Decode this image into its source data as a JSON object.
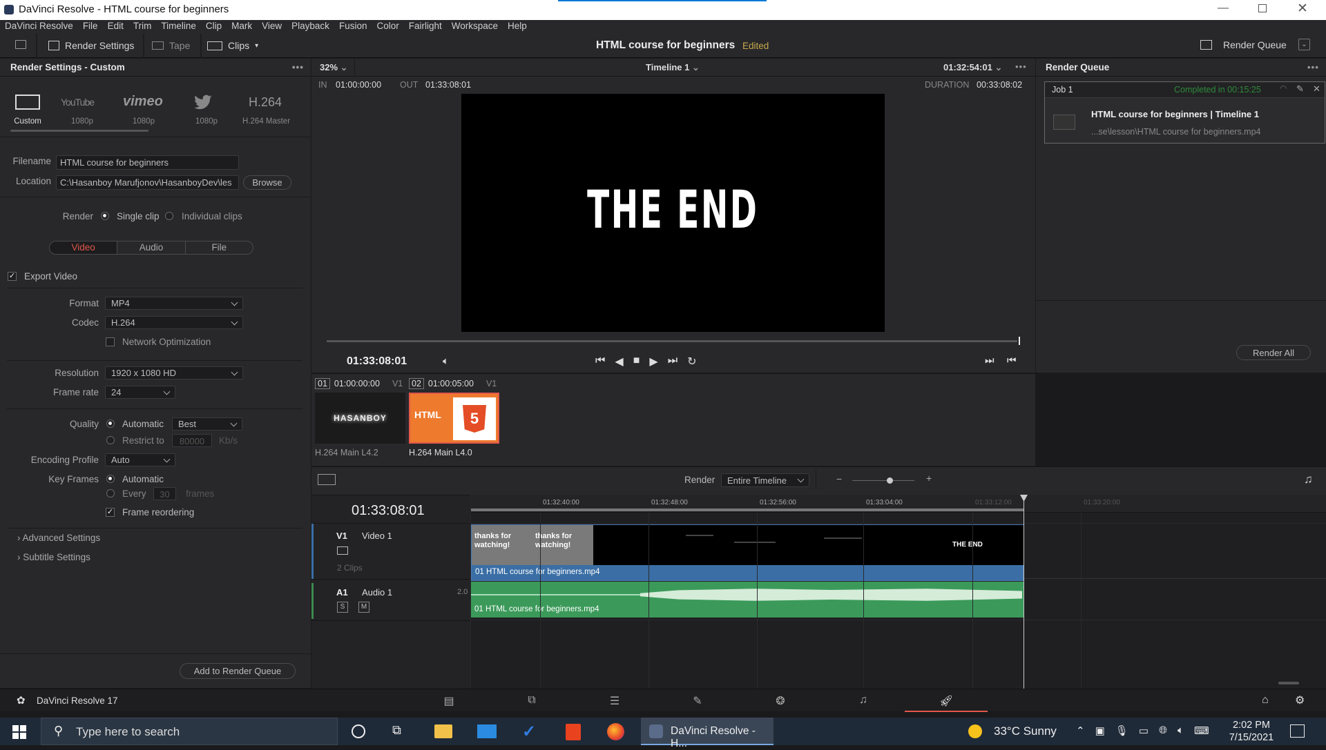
{
  "window": {
    "title": "DaVinci Resolve - HTML course for beginners"
  },
  "menu": [
    "DaVinci Resolve",
    "File",
    "Edit",
    "Trim",
    "Timeline",
    "Clip",
    "Mark",
    "View",
    "Playback",
    "Fusion",
    "Color",
    "Fairlight",
    "Workspace",
    "Help"
  ],
  "toolbar": {
    "render_settings": "Render Settings",
    "tape": "Tape",
    "clips": "Clips",
    "project_title": "HTML course for beginners",
    "edited": "Edited",
    "render_queue": "Render Queue"
  },
  "render_settings": {
    "header": "Render Settings - Custom",
    "presets": [
      {
        "name": "Custom",
        "sub": "Custom"
      },
      {
        "name": "YouTube",
        "sub": "1080p"
      },
      {
        "name": "vimeo",
        "sub": "1080p"
      },
      {
        "name": "Twitter",
        "sub": "1080p"
      },
      {
        "name": "H.264",
        "sub": "H.264 Master"
      }
    ],
    "filename_label": "Filename",
    "filename": "HTML course for beginners",
    "location_label": "Location",
    "location": "C:\\Hasanboy Marufjonov\\HasanboyDev\\les",
    "browse": "Browse",
    "render_label": "Render",
    "single_clip": "Single clip",
    "individual_clips": "Individual clips",
    "tabs": [
      "Video",
      "Audio",
      "File"
    ],
    "export_video": "Export Video",
    "format_label": "Format",
    "format": "MP4",
    "codec_label": "Codec",
    "codec": "H.264",
    "network_opt": "Network Optimization",
    "resolution_label": "Resolution",
    "resolution": "1920 x 1080 HD",
    "framerate_label": "Frame rate",
    "framerate": "24",
    "quality_label": "Quality",
    "automatic": "Automatic",
    "best": "Best",
    "restrict_to": "Restrict to",
    "restrict_value": "80000",
    "kbs": "Kb/s",
    "encoding_label": "Encoding Profile",
    "encoding": "Auto",
    "keyframes_label": "Key Frames",
    "kf_automatic": "Automatic",
    "kf_every": "Every",
    "kf_value": "30",
    "kf_frames": "frames",
    "frame_reordering": "Frame reordering",
    "advanced": "Advanced Settings",
    "subtitle": "Subtitle Settings",
    "add_queue": "Add to Render Queue"
  },
  "viewer": {
    "zoom": "32%",
    "timeline": "Timeline 1",
    "timecode_top": "01:32:54:01",
    "in_label": "IN",
    "in_tc": "01:00:00:00",
    "out_label": "OUT",
    "out_tc": "01:33:08:01",
    "duration_label": "DURATION",
    "duration": "00:33:08:02",
    "screen_text": "THE END",
    "timecode": "01:33:08:01"
  },
  "clips": [
    {
      "num": "01",
      "tc": "01:00:00:00",
      "track": "V1",
      "codec": "H.264 Main L4.2",
      "thumb": "HASANBOY"
    },
    {
      "num": "02",
      "tc": "01:00:05:00",
      "track": "V1",
      "codec": "H.264 Main L4.0",
      "thumb": "HTML"
    }
  ],
  "queue": {
    "header": "Render Queue",
    "job": "Job 1",
    "status": "Completed in 00:15:25",
    "job_title": "HTML course for beginners | Timeline 1",
    "job_path": "...se\\lesson\\HTML course for beginners.mp4",
    "render_all": "Render All"
  },
  "timeline": {
    "render_label": "Render",
    "render_range": "Entire Timeline",
    "timecode": "01:33:08:01",
    "ruler": [
      "01:32:40:00",
      "01:32:48:00",
      "01:32:56:00",
      "01:33:04:00",
      "01:33:12:00",
      "01:33:20:00"
    ],
    "v1": {
      "id": "V1",
      "name": "Video 1",
      "clips": "2 Clips",
      "clip_name": "01 HTML course for beginners.mp4",
      "thumb1": "thanks for watching!",
      "thumb2": "thanks for watching!",
      "end_text": "THE END"
    },
    "a1": {
      "id": "A1",
      "name": "Audio 1",
      "ch": "2.0",
      "s": "S",
      "m": "M",
      "clip_name": "01 HTML course for beginners.mp4"
    }
  },
  "footer": {
    "app": "DaVinci Resolve 17"
  },
  "taskbar": {
    "search": "Type here to search",
    "app": "DaVinci Resolve - H...",
    "weather": "33°C  Sunny",
    "time": "2:02 PM",
    "date": "7/15/2021"
  }
}
